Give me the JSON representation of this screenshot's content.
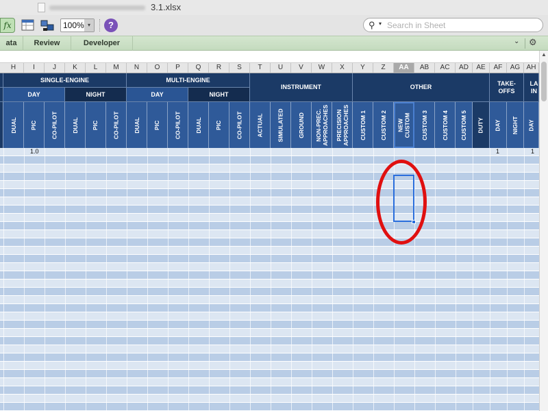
{
  "window": {
    "file_name": "3.1.xlsx"
  },
  "toolbar": {
    "fx_label": "fx",
    "zoom_value": "100%",
    "zoom_arrow": "▾",
    "help_label": "?",
    "search_placeholder": "Search in Sheet",
    "icons": [
      "function-icon",
      "sheet-icon",
      "connection-icon",
      "help-icon",
      "search-icon"
    ]
  },
  "ribbon": {
    "tabs": [
      "ata",
      "Review",
      "Developer"
    ],
    "chevron": "⌄",
    "gear": "⚙"
  },
  "column_headers": [
    "H",
    "I",
    "J",
    "K",
    "L",
    "M",
    "N",
    "O",
    "P",
    "Q",
    "R",
    "S",
    "T",
    "U",
    "V",
    "W",
    "X",
    "Y",
    "Z",
    "AA",
    "AB",
    "AC",
    "AD",
    "AE",
    "AF",
    "AG",
    "AH"
  ],
  "selected_column": "AA",
  "sheet_header": {
    "groups": {
      "single_engine": "SINGLE-ENGINE",
      "multi_engine": "MULTI-ENGINE",
      "instrument": "INSTRUMENT",
      "other": "OTHER",
      "takeoffs": "TAKE-OFFS",
      "landings": "LA IN"
    },
    "sub": {
      "se_day": "DAY",
      "se_night": "NIGHT",
      "me_day": "DAY",
      "me_night": "NIGHT"
    },
    "labels": [
      "DUAL",
      "PIC",
      "CO-PILOT",
      "DUAL",
      "PIC",
      "CO-PILOT",
      "DUAL",
      "PIC",
      "CO-PILOT",
      "DUAL",
      "PIC",
      "CO-PILOT",
      "ACTUAL",
      "SIMULATED",
      "GROUND",
      "NON-PREC. APPROACHES",
      "PRECISION APPROACHES",
      "CUSTOM 1",
      "CUSTOM 2",
      "NEW CUSTOM",
      "CUSTOM 3",
      "CUSTOM 4",
      "CUSTOM 5",
      "DUTY",
      "DAY",
      "NIGHT",
      "DAY"
    ]
  },
  "first_row_values": {
    "pic_se_day": "1.0",
    "takeoffs_day": "1",
    "landings_day": "1"
  },
  "colors": {
    "header_navy": "#1b3a66",
    "header_blue": "#2f5a99",
    "row_light": "#dce6f2",
    "row_dark": "#b9cde6",
    "selection": "#2a6edc",
    "annotation_red": "#e01010",
    "ribbon_green": "#c4dbbe"
  }
}
